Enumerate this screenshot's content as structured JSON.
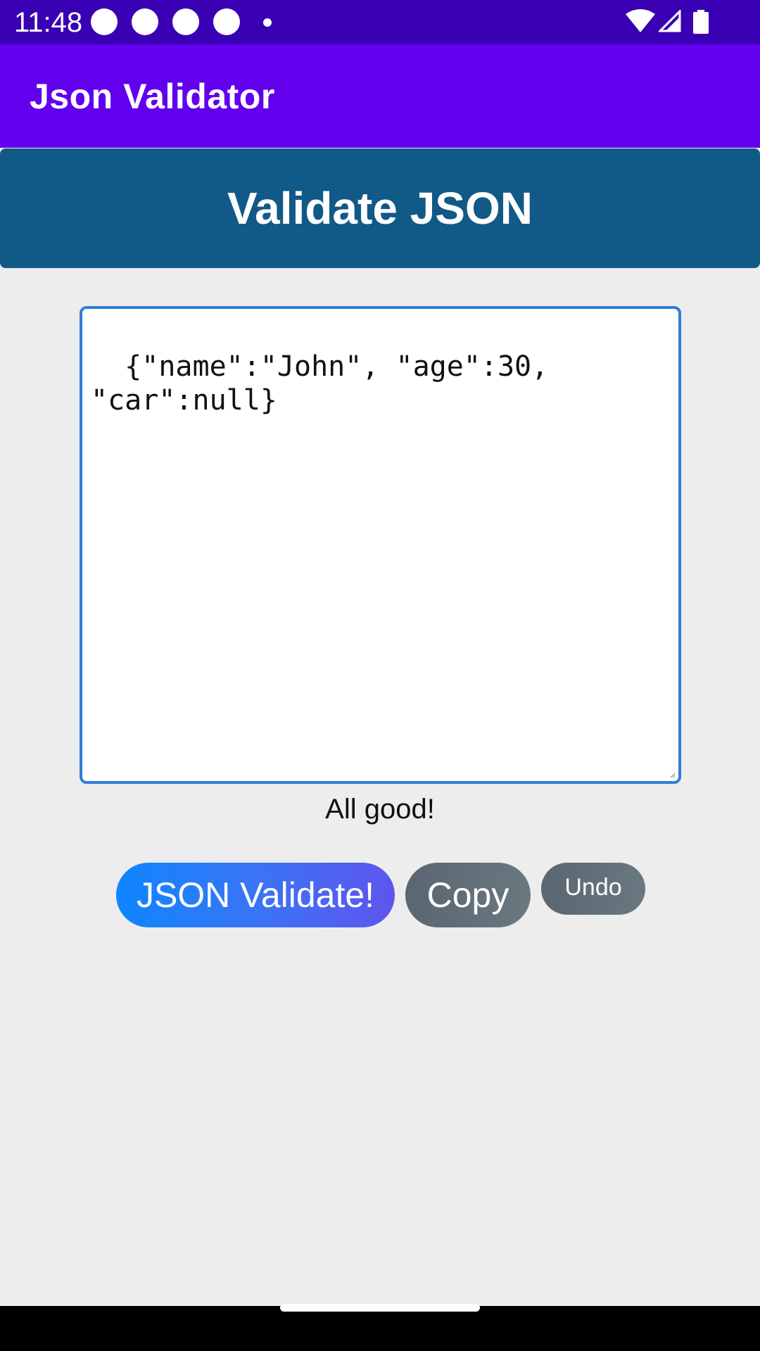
{
  "status_bar": {
    "time": "11:48",
    "icons": [
      "notification-icon",
      "notification-icon",
      "notification-icon",
      "notification-icon",
      "more-notifications-dot",
      "wifi-icon",
      "signal-icon",
      "battery-icon"
    ]
  },
  "app_bar": {
    "title": "Json Validator"
  },
  "header": {
    "title": "Validate JSON"
  },
  "editor": {
    "value": "{\"name\":\"John\", \"age\":30, \"car\":null}"
  },
  "validation": {
    "message": "All good!"
  },
  "buttons": {
    "validate_label": "JSON Validate!",
    "copy_label": "Copy",
    "undo_label": "Undo"
  },
  "colors": {
    "status_bar": "#3a00b3",
    "app_bar": "#6200ee",
    "header_banner": "#115987",
    "background": "#ededed",
    "textarea_border": "#2e7fd8"
  }
}
